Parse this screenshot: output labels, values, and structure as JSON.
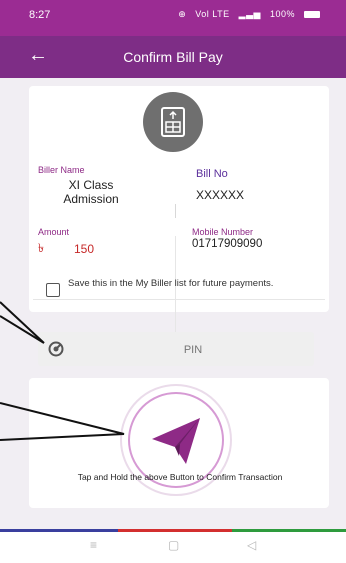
{
  "status_bar": {
    "time": "8:27",
    "signal_text": "Vol LTE",
    "battery_text": "100%"
  },
  "app_bar": {
    "back_icon": "arrow-left-icon",
    "title": "Confirm Bill Pay"
  },
  "bill": {
    "icon": "bill-document-icon",
    "biller_name_label": "Biller Name",
    "biller_name_value": "XI Class\nAdmission",
    "bill_no_label": "Bill No",
    "bill_no_value": "XXXXXX",
    "amount_label": "Amount",
    "amount_currency": "৳",
    "amount_value": "150",
    "mobile_label": "Mobile Number",
    "mobile_value": "01717909090"
  },
  "save_option": {
    "checked": false,
    "label": "Save this in the My Biller list for future payments."
  },
  "pin": {
    "icon": "lock-dial-icon",
    "placeholder": "PIN"
  },
  "confirm": {
    "icon": "send-plane-icon",
    "hint": "Tap and Hold the above Button to Confirm Transaction"
  },
  "colors": {
    "status": "#9b2c93",
    "appbar": "#7e2d86",
    "accent": "#8e2a86",
    "strip": [
      "#3a3f9e",
      "#d32f2f",
      "#2e9b3e"
    ]
  },
  "nav": {
    "items": [
      "menu-icon",
      "home-icon",
      "back-icon"
    ]
  }
}
